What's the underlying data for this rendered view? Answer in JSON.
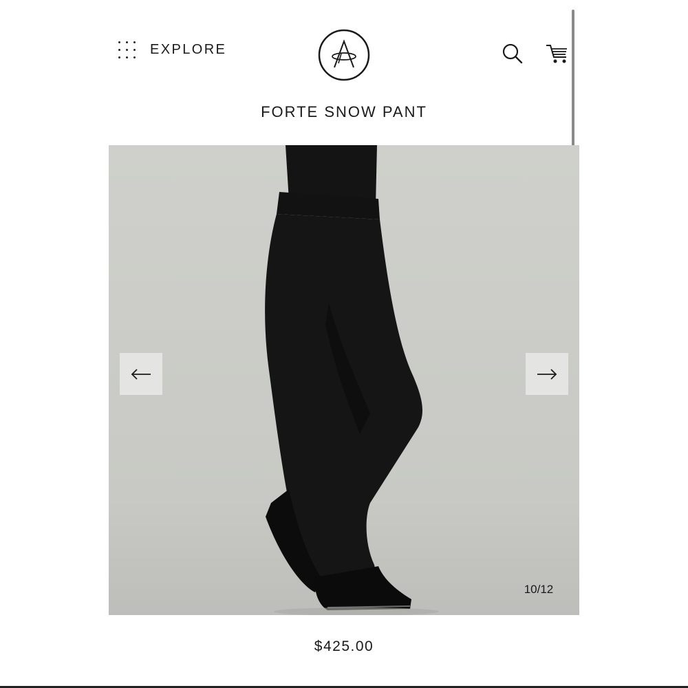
{
  "header": {
    "explore_label": "EXPLORE",
    "icons": [
      "grid-dots-icon",
      "brand-logo",
      "search-icon",
      "cart-icon"
    ]
  },
  "product": {
    "title": "FORTE SNOW PANT",
    "price": "$425.00"
  },
  "gallery": {
    "counter": "10/12",
    "current_index": 10,
    "total_images": 12,
    "image_description": "Model wearing black flared snow pants and black hiking boots against light grey backdrop",
    "background_color": "#cfd0cb"
  },
  "colors": {
    "text": "#1a1a1a",
    "nav_button_bg": "#e4e5e2"
  }
}
